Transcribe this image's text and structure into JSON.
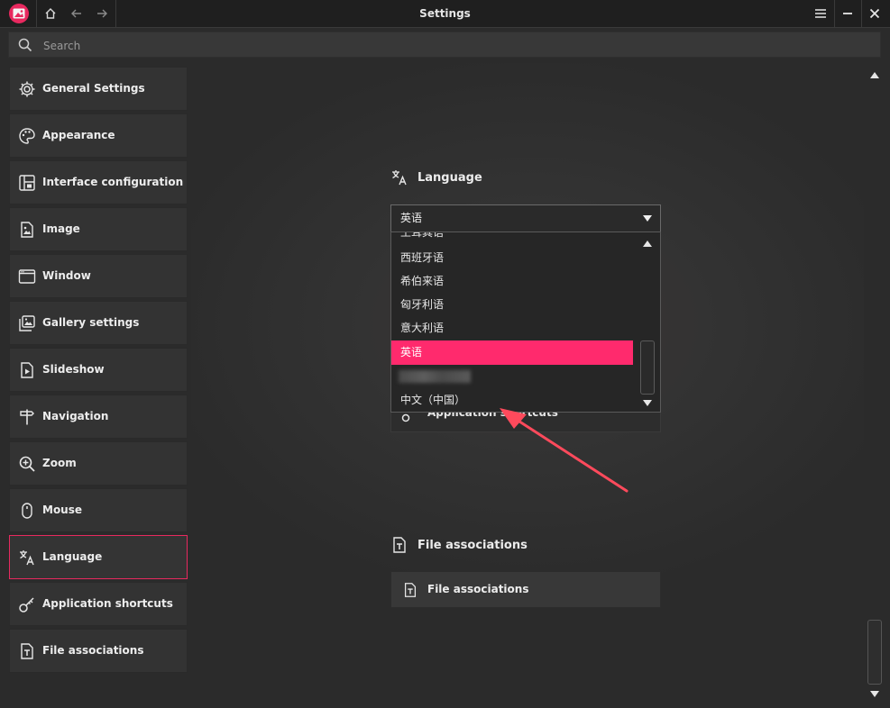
{
  "window": {
    "title": "Settings"
  },
  "search": {
    "placeholder": "Search"
  },
  "sidebar": {
    "items": [
      {
        "label": "General Settings",
        "icon": "gear-icon"
      },
      {
        "label": "Appearance",
        "icon": "palette-icon"
      },
      {
        "label": "Interface configuration",
        "icon": "layout-icon"
      },
      {
        "label": "Image",
        "icon": "image-file-icon"
      },
      {
        "label": "Window",
        "icon": "window-icon"
      },
      {
        "label": "Gallery settings",
        "icon": "gallery-icon"
      },
      {
        "label": "Slideshow",
        "icon": "slideshow-icon"
      },
      {
        "label": "Navigation",
        "icon": "signpost-icon"
      },
      {
        "label": "Zoom",
        "icon": "zoom-in-icon"
      },
      {
        "label": "Mouse",
        "icon": "mouse-icon"
      },
      {
        "label": "Language",
        "icon": "translate-icon",
        "active": true
      },
      {
        "label": "Application shortcuts",
        "icon": "key-icon"
      },
      {
        "label": "File associations",
        "icon": "file-text-icon"
      }
    ]
  },
  "language_section": {
    "heading": "Language",
    "selected_value": "英语",
    "options": [
      {
        "label": "土耳其语"
      },
      {
        "label": "西班牙语"
      },
      {
        "label": "希伯来语"
      },
      {
        "label": "匈牙利语"
      },
      {
        "label": "意大利语"
      },
      {
        "label": "英语",
        "selected": true
      },
      {
        "label": "",
        "obscured": true
      },
      {
        "label": "中文（中国）"
      }
    ],
    "partially_hidden_row_label": "Application shortcuts"
  },
  "file_associations_section": {
    "heading": "File associations",
    "button_label": "File associations"
  },
  "colors": {
    "accent": "#ff2a6d",
    "active_border": "#e8295f",
    "background": "#2b2b2b",
    "panel": "#333333"
  }
}
